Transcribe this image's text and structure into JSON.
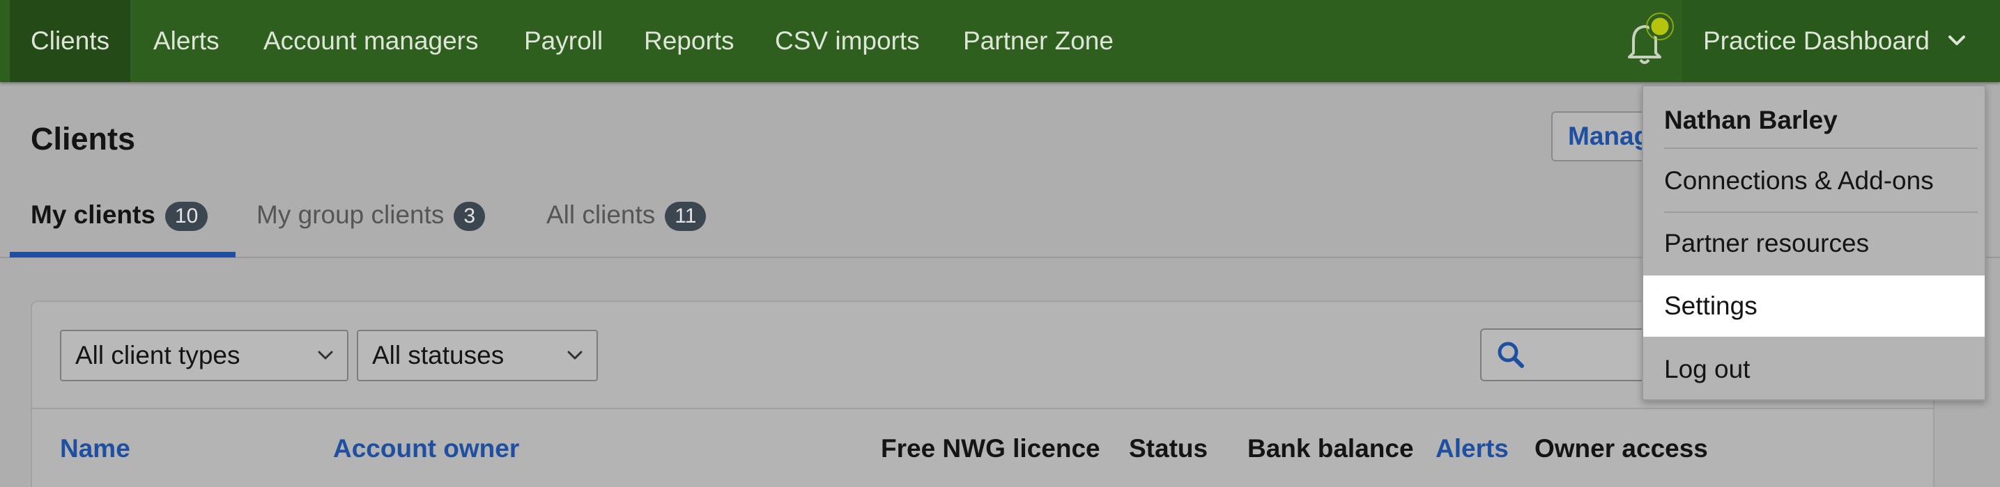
{
  "nav": {
    "items": [
      {
        "label": "Clients",
        "active": true
      },
      {
        "label": "Alerts"
      },
      {
        "label": "Account managers"
      },
      {
        "label": "Payroll"
      },
      {
        "label": "Reports"
      },
      {
        "label": "CSV imports"
      },
      {
        "label": "Partner Zone"
      }
    ],
    "practice_label": "Practice Dashboard",
    "bell_icon": "notification-bell-icon"
  },
  "page": {
    "title": "Clients",
    "manage_button": "Manage"
  },
  "tabs": [
    {
      "label": "My clients",
      "count": "10",
      "active": true
    },
    {
      "label": "My group clients",
      "count": "3"
    },
    {
      "label": "All clients",
      "count": "11"
    }
  ],
  "filters": {
    "client_type": "All client types",
    "status": "All statuses",
    "search_icon": "search-icon"
  },
  "table": {
    "columns": [
      "Name",
      "Account owner",
      "Free NWG licence",
      "Status",
      "Bank balance",
      "Alerts",
      "Owner access"
    ]
  },
  "dropdown": {
    "user_name": "Nathan Barley",
    "items": [
      "Connections & Add-ons",
      "Partner resources",
      "Settings",
      "Log out"
    ],
    "highlighted": "Settings"
  },
  "colors": {
    "nav_bg": "#2f5f1f",
    "nav_active_bg": "#234a17",
    "link_blue": "#1f4fa0",
    "badge_bg": "#3c4650",
    "bell_dot": "#b7c40e"
  }
}
